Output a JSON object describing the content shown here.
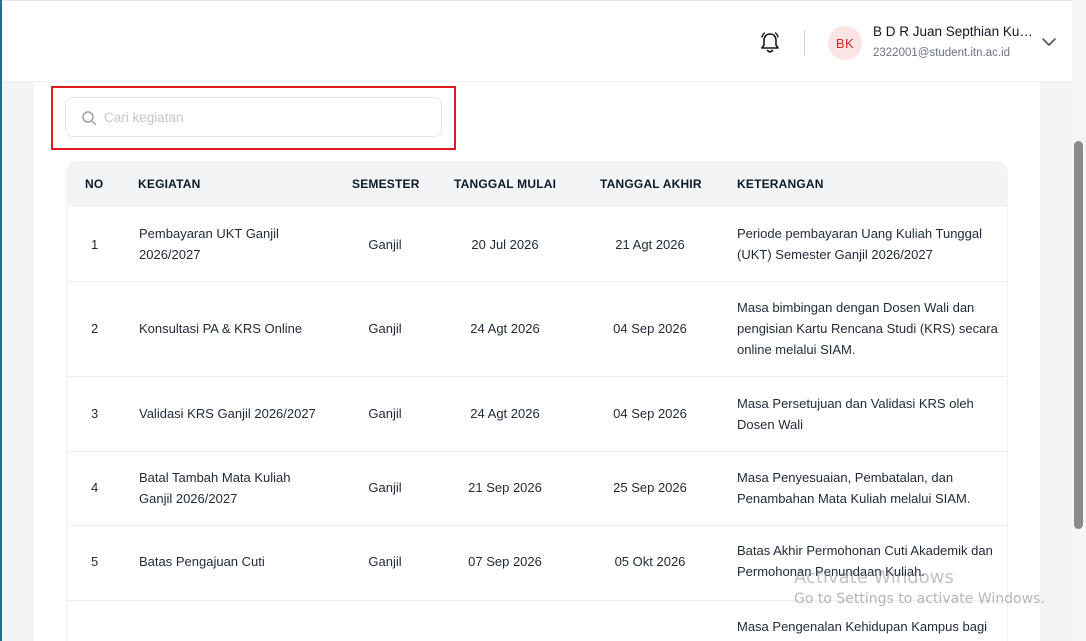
{
  "header": {
    "user_initials": "BK",
    "user_name": "B D R Juan Septhian Kur...",
    "user_email": "2322001@student.itn.ac.id"
  },
  "search": {
    "placeholder": "Cari kegiatan",
    "value": ""
  },
  "table": {
    "columns": [
      "NO",
      "KEGIATAN",
      "SEMESTER",
      "TANGGAL MULAI",
      "TANGGAL AKHIR",
      "KETERANGAN"
    ],
    "rows": [
      {
        "no": "1",
        "kegiatan": "Pembayaran UKT Ganjil 2026/2027",
        "semester": "Ganjil",
        "mulai": "20 Jul 2026",
        "akhir": "21 Agt 2026",
        "keterangan": "Periode pembayaran Uang Kuliah Tunggal (UKT) Semester Ganjil 2026/2027"
      },
      {
        "no": "2",
        "kegiatan": "Konsultasi PA & KRS Online",
        "semester": "Ganjil",
        "mulai": "24 Agt 2026",
        "akhir": "04 Sep 2026",
        "keterangan": "Masa bimbingan dengan Dosen Wali dan pengisian Kartu Rencana Studi (KRS) secara online melalui SIAM."
      },
      {
        "no": "3",
        "kegiatan": "Validasi KRS Ganjil 2026/2027",
        "semester": "Ganjil",
        "mulai": "24 Agt 2026",
        "akhir": "04 Sep 2026",
        "keterangan": "Masa Persetujuan dan Validasi KRS oleh Dosen Wali"
      },
      {
        "no": "4",
        "kegiatan": "Batal Tambah Mata Kuliah Ganjil 2026/2027",
        "semester": "Ganjil",
        "mulai": "21 Sep 2026",
        "akhir": "25 Sep 2026",
        "keterangan": "Masa Penyesuaian, Pembatalan, dan Penambahan Mata Kuliah melalui SIAM."
      },
      {
        "no": "5",
        "kegiatan": "Batas Pengajuan Cuti",
        "semester": "Ganjil",
        "mulai": "07 Sep 2026",
        "akhir": "05 Okt 2026",
        "keterangan": "Batas Akhir Permohonan Cuti Akademik dan Permohonan Penundaan Kuliah."
      },
      {
        "no": "",
        "kegiatan": "",
        "semester": "",
        "mulai": "",
        "akhir": "",
        "keterangan": "Masa Pengenalan Kehidupan Kampus bagi"
      }
    ]
  },
  "watermark": {
    "line1": "Activate Windows",
    "line2": "Go to Settings to activate Windows."
  },
  "icons": {
    "notification": "bell-icon",
    "search": "search-icon",
    "dropdown": "chevron-down-icon"
  },
  "colors": {
    "highlight": "#e01b1b",
    "avatar_bg": "#fde4e4",
    "avatar_text": "#dc2626"
  }
}
